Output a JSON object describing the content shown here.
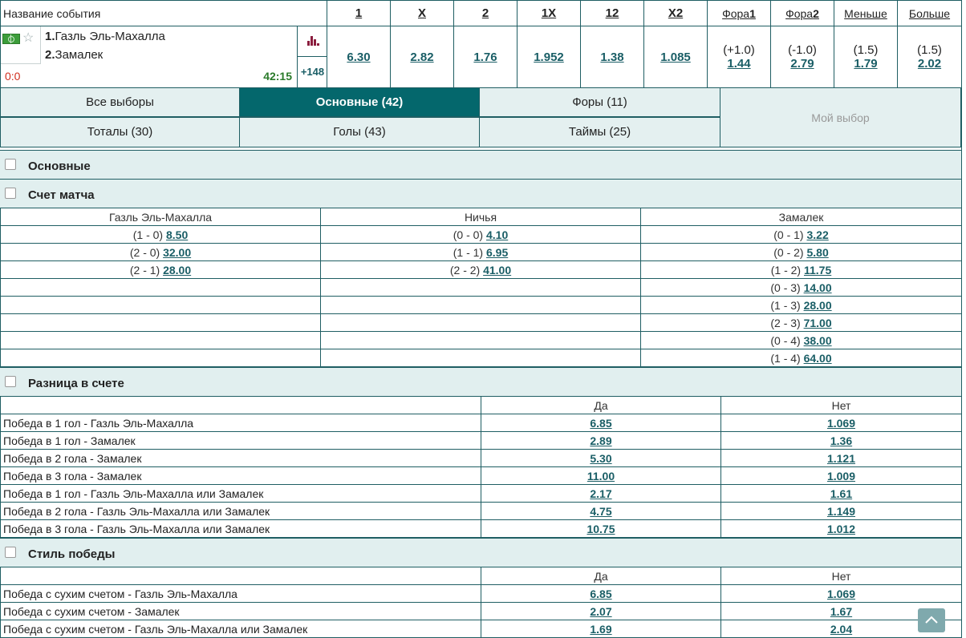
{
  "header": {
    "event_name_label": "Название события",
    "columns": [
      "1",
      "X",
      "2",
      "1X",
      "12",
      "X2"
    ],
    "fora1_prefix": "Фора",
    "fora1_suffix": "1",
    "fora2_prefix": "Фора",
    "fora2_suffix": "2",
    "less_label": "Меньше",
    "more_label": "Больше"
  },
  "event": {
    "team1_num": "1.",
    "team1": "Газль Эль-Махалла",
    "team2_num": "2.",
    "team2": "Замалек",
    "score": "0:0",
    "time": "42:15",
    "more_markets": "+148",
    "odds": [
      "6.30",
      "2.82",
      "1.76",
      "1.952",
      "1.38",
      "1.085"
    ],
    "fora1_param": "(+1.0)",
    "fora1_odd": "1.44",
    "fora2_param": "(-1.0)",
    "fora2_odd": "2.79",
    "less_param": "(1.5)",
    "less_odd": "1.79",
    "more_param": "(1.5)",
    "more_odd": "2.02"
  },
  "tabs": {
    "all": "Все выборы",
    "main": "Основные (42)",
    "foras": "Форы (11)",
    "totals": "Тоталы (30)",
    "goals": "Голы (43)",
    "halves": "Таймы (25)",
    "my_choice": "Мой выбор"
  },
  "sections": {
    "main": "Основные",
    "correct_score": "Счет матча",
    "score_diff": "Разница в счете",
    "win_style": "Стиль победы"
  },
  "correct_score": {
    "headers": [
      "Газль Эль-Махалла",
      "Ничья",
      "Замалек"
    ],
    "rows": [
      [
        {
          "s": "(1 - 0)",
          "o": "8.50"
        },
        {
          "s": "(0 - 0)",
          "o": "4.10"
        },
        {
          "s": "(0 - 1)",
          "o": "3.22"
        }
      ],
      [
        {
          "s": "(2 - 0)",
          "o": "32.00"
        },
        {
          "s": "(1 - 1)",
          "o": "6.95"
        },
        {
          "s": "(0 - 2)",
          "o": "5.80"
        }
      ],
      [
        {
          "s": "(2 - 1)",
          "o": "28.00"
        },
        {
          "s": "(2 - 2)",
          "o": "41.00"
        },
        {
          "s": "(1 - 2)",
          "o": "11.75"
        }
      ],
      [
        null,
        null,
        {
          "s": "(0 - 3)",
          "o": "14.00"
        }
      ],
      [
        null,
        null,
        {
          "s": "(1 - 3)",
          "o": "28.00"
        }
      ],
      [
        null,
        null,
        {
          "s": "(2 - 3)",
          "o": "71.00"
        }
      ],
      [
        null,
        null,
        {
          "s": "(0 - 4)",
          "o": "38.00"
        }
      ],
      [
        null,
        null,
        {
          "s": "(1 - 4)",
          "o": "64.00"
        }
      ]
    ]
  },
  "score_diff": {
    "headers": [
      "Да",
      "Нет"
    ],
    "rows": [
      {
        "label": "Победа в 1 гол - Газль Эль-Махалла",
        "yes": "6.85",
        "no": "1.069"
      },
      {
        "label": "Победа в 1 гол - Замалек",
        "yes": "2.89",
        "no": "1.36"
      },
      {
        "label": "Победа в 2 гола - Замалек",
        "yes": "5.30",
        "no": "1.121"
      },
      {
        "label": "Победа в 3 гола - Замалек",
        "yes": "11.00",
        "no": "1.009"
      },
      {
        "label": "Победа в 1 гол - Газль Эль-Махалла или Замалек",
        "yes": "2.17",
        "no": "1.61"
      },
      {
        "label": "Победа в 2 гола - Газль Эль-Махалла или Замалек",
        "yes": "4.75",
        "no": "1.149"
      },
      {
        "label": "Победа в 3 гола - Газль Эль-Махалла или Замалек",
        "yes": "10.75",
        "no": "1.012"
      }
    ]
  },
  "win_style": {
    "headers": [
      "Да",
      "Нет"
    ],
    "rows": [
      {
        "label": "Победа с сухим счетом - Газль Эль-Махалла",
        "yes": "6.85",
        "no": "1.069"
      },
      {
        "label": "Победа с сухим счетом - Замалек",
        "yes": "2.07",
        "no": "1.67"
      },
      {
        "label": "Победа с сухим счетом - Газль Эль-Махалла или Замалек",
        "yes": "1.69",
        "no": "2.04"
      }
    ]
  },
  "icons": {
    "sport": "soccer-field-icon",
    "favorite": "star-icon",
    "stats": "bar-chart-icon",
    "scroll_top": "chevron-up-icon"
  },
  "colors": {
    "accent": "#04676c",
    "odd_link": "#1a5e66",
    "score_red": "#d12e1e",
    "time_green": "#2a7a2a",
    "section_bg": "#e1efef"
  }
}
